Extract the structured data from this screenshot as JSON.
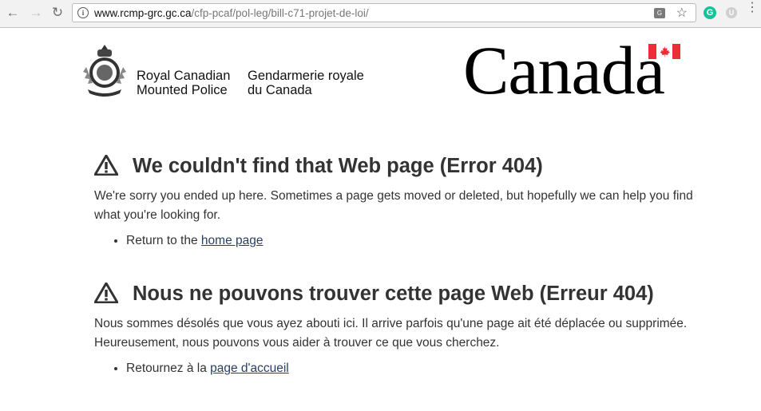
{
  "browser": {
    "url_host": "www.rcmp-grc.gc.ca",
    "url_path": "/cfp-pcaf/pol-leg/bill-c71-projet-de-loi/",
    "icons": [
      "back-icon",
      "forward-icon",
      "reload-icon",
      "info-icon",
      "translate-icon",
      "star-icon",
      "grammarly-extension-icon",
      "extension-u-icon",
      "menu-icon"
    ],
    "ext_g_label": "G",
    "ext_u_label": "U"
  },
  "header": {
    "signature_en_line1": "Royal Canadian",
    "signature_en_line2": "Mounted Police",
    "signature_fr_line1": "Gendarmerie royale",
    "signature_fr_line2": "du Canada",
    "wordmark": "Canada",
    "flag_color": "#eb2d37"
  },
  "english": {
    "heading": "We couldn't find that Web page (Error 404)",
    "paragraph": "We're sorry you ended up here. Sometimes a page gets moved or deleted, but hopefully we can help you find what you're looking for.",
    "list_prefix": "Return to the ",
    "link_label": "home page"
  },
  "french": {
    "heading": "Nous ne pouvons trouver cette page Web (Erreur 404)",
    "paragraph": "Nous sommes désolés que vous ayez abouti ici. Il arrive parfois qu'une page ait été déplacée ou supprimée. Heureusement, nous pouvons vous aider à trouver ce que vous cherchez.",
    "list_prefix": "Retournez à la ",
    "link_label": "page d'accueil"
  },
  "colors": {
    "link": "#284162",
    "text": "#333333"
  }
}
